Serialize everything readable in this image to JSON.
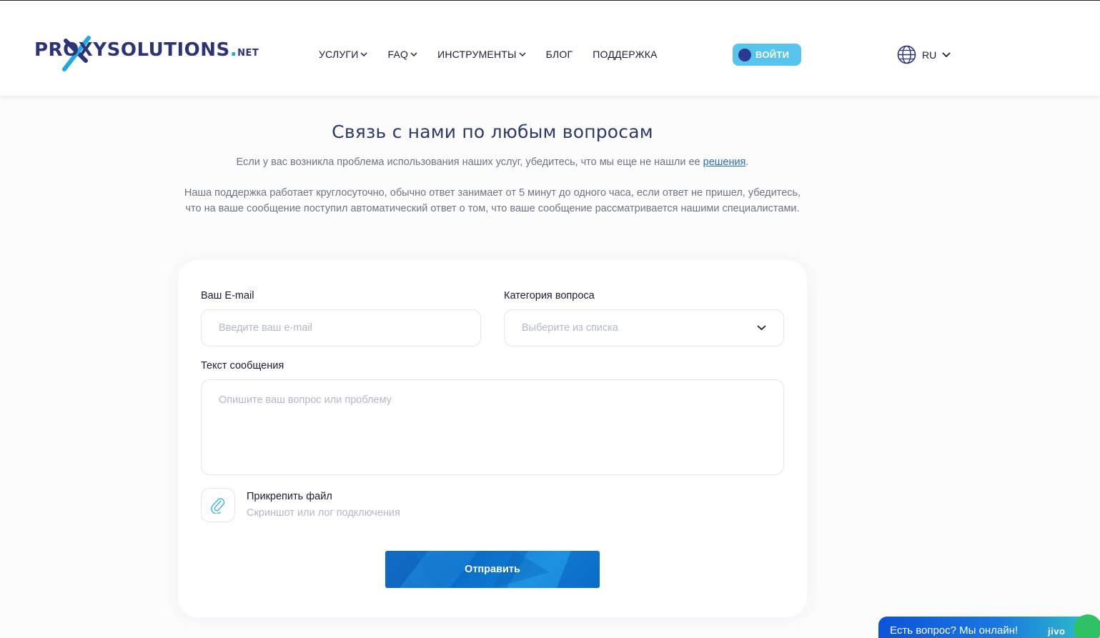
{
  "logo": {
    "brand": "PROXYSOLUTIONS",
    "dot": ".",
    "suffix": "NET"
  },
  "nav": {
    "items": [
      {
        "label": "УСЛУГИ",
        "has_dropdown": true
      },
      {
        "label": "FAQ",
        "has_dropdown": true
      },
      {
        "label": "ИНСТРУМЕНТЫ",
        "has_dropdown": true
      },
      {
        "label": "БЛОГ",
        "has_dropdown": false
      },
      {
        "label": "ПОДДЕРЖКА",
        "has_dropdown": false
      }
    ]
  },
  "login": {
    "label": "ВОЙТИ"
  },
  "language": {
    "current": "RU",
    "icon": "globe-icon"
  },
  "page": {
    "title": "Связь с нами по любым вопросам",
    "intro_prefix": "Если у вас возникла проблема использования наших услуг, убедитесь, что мы еще не нашли ее ",
    "intro_link": "решения",
    "intro_suffix": ".",
    "support_text": "Наша поддержка работает круглосуточно, обычно ответ занимает от 5 минут до одного часа, если ответ не пришел, убедитесь, что на ваше сообщение поступил автоматический ответ о том, что ваше сообщение рассматривается нашими специалистами."
  },
  "form": {
    "email_label": "Ваш E-mail",
    "email_placeholder": "Введите ваш e-mail",
    "category_label": "Категория вопроса",
    "category_placeholder": "Выберите из списка",
    "message_label": "Текст сообщения",
    "message_placeholder": "Опишите ваш вопрос или проблему",
    "attach_title": "Прикрепить файл",
    "attach_subtitle": "Скриншот или лог подключения",
    "submit_label": "Отправить"
  },
  "chat": {
    "label": "Есть вопрос? Мы онлайн!",
    "brand": "jivo"
  },
  "colors": {
    "brand_navy": "#2d3476",
    "brand_cyan": "#20a8e0",
    "login_bg": "#56c4ec",
    "submit_bg": "#0a6cc8",
    "chat_bg": "#0c53d8"
  }
}
